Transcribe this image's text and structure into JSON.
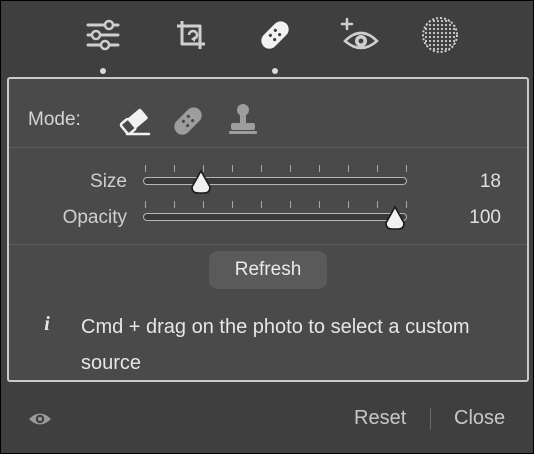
{
  "toolbar": {
    "tools": [
      {
        "icon": "sliders-icon",
        "active_dot": true
      },
      {
        "icon": "crop-rotate-icon",
        "active_dot": false
      },
      {
        "icon": "bandage-icon",
        "active_dot": true
      },
      {
        "icon": "red-eye-icon",
        "active_dot": false
      },
      {
        "icon": "masking-icon",
        "active_dot": false
      }
    ]
  },
  "panel": {
    "mode_label": "Mode:",
    "modes": [
      "eraser-icon",
      "heal-bandage-icon",
      "clone-stamp-icon"
    ],
    "sliders": {
      "size": {
        "label": "Size",
        "value": "18",
        "fraction": 0.19
      },
      "opacity": {
        "label": "Opacity",
        "value": "100",
        "fraction": 1.0
      }
    },
    "refresh_label": "Refresh",
    "info_icon_glyph": "i",
    "info_text": "Cmd + drag on the photo to select a custom source"
  },
  "footer": {
    "reset_label": "Reset",
    "close_label": "Close"
  },
  "colors": {
    "background": "#3f3f3f",
    "panel": "#4a4a4a",
    "panel_border": "#c9c9c9",
    "text": "#e6e6e6"
  }
}
